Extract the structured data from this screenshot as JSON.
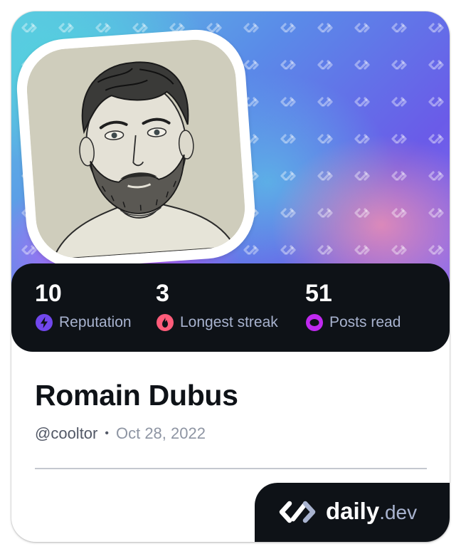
{
  "profile": {
    "name": "Romain Dubus",
    "handle": "@cooltor",
    "separator": "•",
    "joined": "Oct 28, 2022",
    "avatar_alt": "Profile picture"
  },
  "stats": [
    {
      "value": "10",
      "label": "Reputation",
      "icon": "reputation-bolt-icon",
      "color": "#7147ed"
    },
    {
      "value": "3",
      "label": "Longest streak",
      "icon": "streak-flame-icon",
      "color": "#ff5c7a"
    },
    {
      "value": "51",
      "label": "Posts read",
      "icon": "posts-read-ring-icon",
      "color": "#c029f0"
    }
  ],
  "brand": {
    "name_bold": "daily",
    "name_suffix": ".dev"
  },
  "colors": {
    "dark": "#0e1217",
    "label": "#a8b3cf",
    "reputation": "#7147ed",
    "streak": "#ff5c7a",
    "posts_read": "#c029f0"
  }
}
